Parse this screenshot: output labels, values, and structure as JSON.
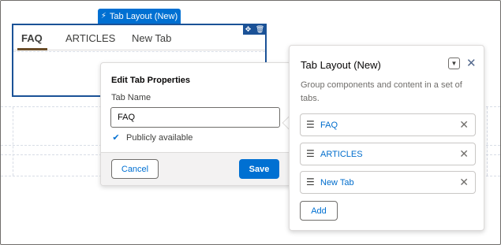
{
  "component": {
    "label": "Tab Layout (New)",
    "bolt_icon": "bolt-icon",
    "move_icon": "move-icon",
    "delete_icon": "trash-icon",
    "tabs": [
      "FAQ",
      "ARTICLES",
      "New Tab"
    ],
    "active_tab_color": "#6b4e2a"
  },
  "edit_popover": {
    "title": "Edit Tab Properties",
    "tab_name_label": "Tab Name",
    "tab_name_value": "FAQ",
    "publicly_available_label": "Publicly available",
    "publicly_available_checked": true,
    "cancel_label": "Cancel",
    "save_label": "Save"
  },
  "panel": {
    "title": "Tab Layout (New)",
    "description": "Group components and content in a set of tabs.",
    "dropdown_icon": "chevron-down-icon",
    "close_icon": "close-icon",
    "tabs": [
      {
        "name": "FAQ"
      },
      {
        "name": "ARTICLES"
      },
      {
        "name": "New Tab"
      }
    ],
    "add_label": "Add"
  },
  "colors": {
    "brand_blue": "#0070d2",
    "selection_border": "#1b5297"
  }
}
